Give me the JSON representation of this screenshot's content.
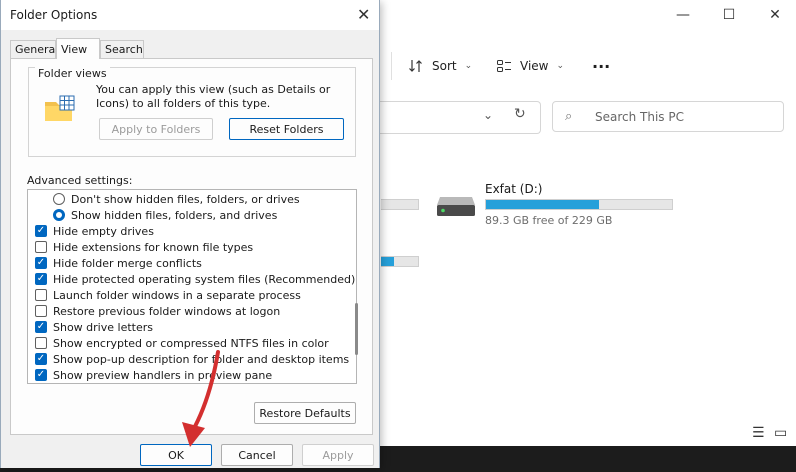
{
  "explorer": {
    "window_controls": {
      "minimize": "—",
      "maximize": "☐",
      "close": "✕"
    },
    "command_bar": {
      "sort_label": "Sort",
      "view_label": "View",
      "more_label": "···"
    },
    "search": {
      "placeholder": "Search This PC"
    },
    "drives": [
      {
        "name": "Exfat (D:)",
        "free_text": "89.3 GB free of 229 GB",
        "used_fraction": 0.61
      }
    ],
    "accent_color": "#26a0da"
  },
  "dialog": {
    "title": "Folder Options",
    "close_glyph": "✕",
    "tabs": [
      {
        "label": "General",
        "selected": false
      },
      {
        "label": "View",
        "selected": true
      },
      {
        "label": "Search",
        "selected": false
      }
    ],
    "folder_views": {
      "group_title": "Folder views",
      "description": "You can apply this view (such as Details or Icons) to all folders of this type.",
      "apply_button": "Apply to Folders",
      "reset_button": "Reset Folders"
    },
    "advanced_label": "Advanced settings:",
    "advanced_items": [
      {
        "type": "radio",
        "checked": false,
        "label": "Don't show hidden files, folders, or drives"
      },
      {
        "type": "radio",
        "checked": true,
        "label": "Show hidden files, folders, and drives"
      },
      {
        "type": "checkbox",
        "checked": true,
        "label": "Hide empty drives"
      },
      {
        "type": "checkbox",
        "checked": false,
        "label": "Hide extensions for known file types"
      },
      {
        "type": "checkbox",
        "checked": true,
        "label": "Hide folder merge conflicts"
      },
      {
        "type": "checkbox",
        "checked": true,
        "label": "Hide protected operating system files (Recommended)"
      },
      {
        "type": "checkbox",
        "checked": false,
        "label": "Launch folder windows in a separate process"
      },
      {
        "type": "checkbox",
        "checked": false,
        "label": "Restore previous folder windows at logon"
      },
      {
        "type": "checkbox",
        "checked": true,
        "label": "Show drive letters"
      },
      {
        "type": "checkbox",
        "checked": false,
        "label": "Show encrypted or compressed NTFS files in color"
      },
      {
        "type": "checkbox",
        "checked": true,
        "label": "Show pop-up description for folder and desktop items"
      },
      {
        "type": "checkbox",
        "checked": true,
        "label": "Show preview handlers in preview pane"
      }
    ],
    "restore_defaults": "Restore Defaults",
    "ok": "OK",
    "cancel": "Cancel",
    "apply": "Apply",
    "arrow_color": "#d32f2f"
  }
}
